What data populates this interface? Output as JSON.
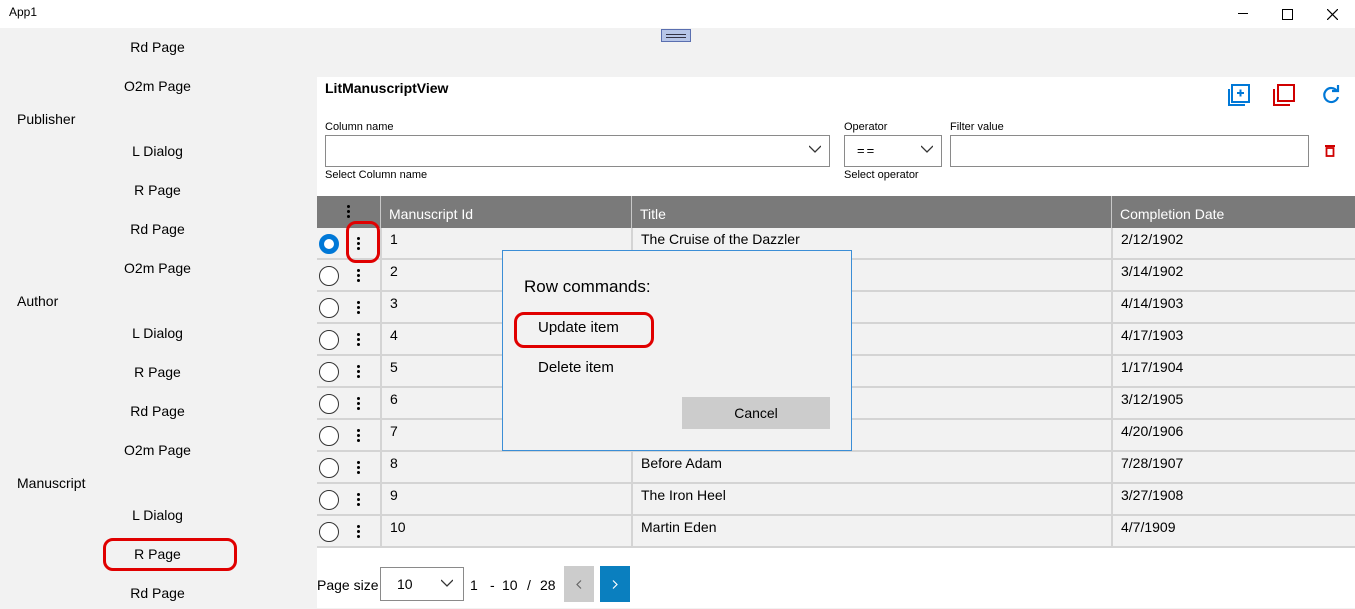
{
  "window": {
    "title": "App1",
    "minimize_icon": "minimize-icon",
    "maximize_icon": "maximize-icon",
    "close_icon": "close-icon"
  },
  "sidebar": {
    "items": [
      {
        "label": "Rd Page",
        "type": "sub"
      },
      {
        "label": "O2m Page",
        "type": "sub"
      },
      {
        "label": "Publisher",
        "type": "head"
      },
      {
        "label": "L Dialog",
        "type": "sub"
      },
      {
        "label": "R Page",
        "type": "sub"
      },
      {
        "label": "Rd Page",
        "type": "sub"
      },
      {
        "label": "O2m Page",
        "type": "sub"
      },
      {
        "label": "Author",
        "type": "head"
      },
      {
        "label": "L Dialog",
        "type": "sub"
      },
      {
        "label": "R Page",
        "type": "sub"
      },
      {
        "label": "Rd Page",
        "type": "sub"
      },
      {
        "label": "O2m Page",
        "type": "sub"
      },
      {
        "label": "Manuscript",
        "type": "head"
      },
      {
        "label": "L Dialog",
        "type": "sub"
      },
      {
        "label": "R Page",
        "type": "sub",
        "highlighted": true
      },
      {
        "label": "Rd Page",
        "type": "sub"
      }
    ]
  },
  "view": {
    "title": "LitManuscriptView",
    "toolbar": {
      "add_icon": "add-item-icon",
      "select_icon": "multi-select-icon",
      "refresh_icon": "refresh-icon"
    },
    "filter": {
      "column_label": "Column name",
      "column_value": "",
      "column_hint": "Select Column name",
      "operator_label": "Operator",
      "operator_value": "==",
      "operator_hint": "Select operator",
      "value_label": "Filter value",
      "value_value": "",
      "clear_icon": "trash-icon"
    },
    "grid": {
      "columns": [
        "Manuscript Id",
        "Title",
        "Completion Date"
      ],
      "rows": [
        {
          "id": "1",
          "title": "The Cruise of the Dazzler",
          "date": "2/12/1902",
          "selected": true
        },
        {
          "id": "2",
          "title": "",
          "date": "3/14/1902"
        },
        {
          "id": "3",
          "title": "",
          "date": "4/14/1903"
        },
        {
          "id": "4",
          "title": "",
          "date": "4/17/1903"
        },
        {
          "id": "5",
          "title": "",
          "date": "1/17/1904"
        },
        {
          "id": "6",
          "title": "",
          "date": "3/12/1905"
        },
        {
          "id": "7",
          "title": "",
          "date": "4/20/1906"
        },
        {
          "id": "8",
          "title": "Before Adam",
          "date": "7/28/1907"
        },
        {
          "id": "9",
          "title": "The Iron Heel",
          "date": "3/27/1908"
        },
        {
          "id": "10",
          "title": "Martin Eden",
          "date": "4/7/1909"
        }
      ]
    },
    "pager": {
      "page_size_label": "Page size",
      "page_size": "10",
      "range_start": "1",
      "range_sep": "-",
      "range_end": "10",
      "total_sep": "/",
      "total": "28",
      "prev_icon": "chevron-left-icon",
      "next_icon": "chevron-right-icon"
    }
  },
  "dialog": {
    "title": "Row commands:",
    "update_label": "Update item",
    "delete_label": "Delete item",
    "cancel_label": "Cancel"
  },
  "colors": {
    "accent": "#0078d7",
    "annotation": "#e00000",
    "header_bg": "#7a7a7a"
  }
}
